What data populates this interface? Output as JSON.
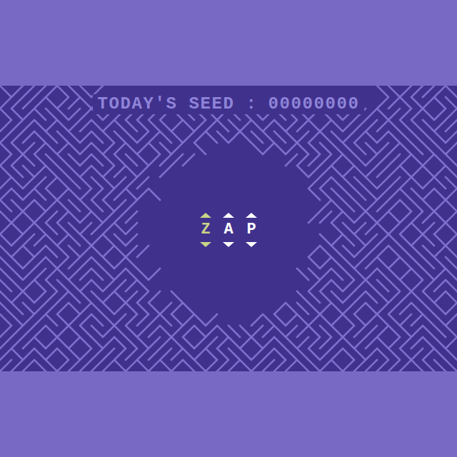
{
  "seed": {
    "label": "TODAY'S SEED :",
    "value": "00000000"
  },
  "letters": [
    {
      "letter": "Z",
      "selected": true
    },
    {
      "letter": "A",
      "selected": false
    },
    {
      "letter": "P",
      "selected": false
    }
  ]
}
